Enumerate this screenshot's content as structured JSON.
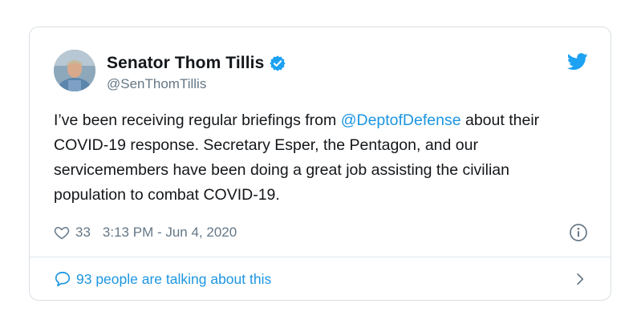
{
  "tweet": {
    "author": {
      "display_name": "Senator Thom Tillis",
      "handle": "@SenThomTillis",
      "verified": true
    },
    "text_parts": {
      "before_mention": "I’ve been receiving regular briefings from ",
      "mention": "@DeptofDefense",
      "after_mention": " about their COVID-19 response. Secretary Esper, the Pentagon, and our servicemembers have been doing a great job assisting the civilian population to combat COVID-19."
    },
    "likes": "33",
    "timestamp": "3:13 PM - Jun 4, 2020",
    "talking": "93 people are talking about this"
  },
  "icons": {
    "brand": "twitter-bird-icon",
    "verified": "verified-badge-icon",
    "like": "heart-icon",
    "info": "info-icon",
    "reply": "speech-bubble-icon",
    "chevron": "chevron-right-icon"
  },
  "colors": {
    "brand_blue": "#1da1f2",
    "link_blue": "#1b95e0",
    "text": "#14171a",
    "muted": "#657786",
    "border": "#d9dfe4"
  }
}
